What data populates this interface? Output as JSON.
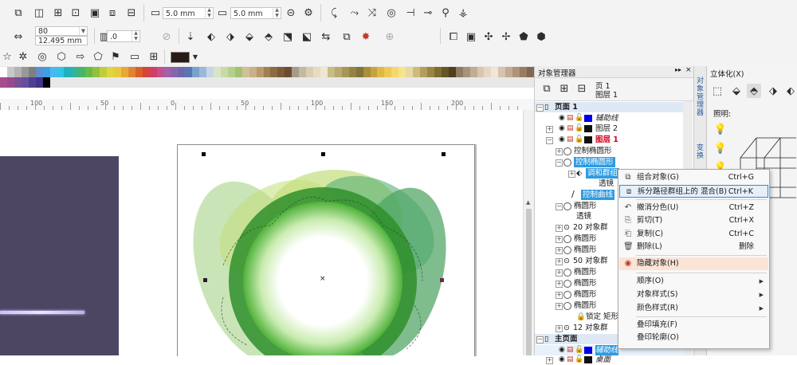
{
  "toolbar1": {
    "nudge1": "5.0 mm",
    "nudge2": "5.0 mm"
  },
  "toolbar2": {
    "width_value": "80",
    "height_value": "12.495 mm",
    "angle_value": ".0"
  },
  "toolbar3": {
    "fill_color": "#2a1a16"
  },
  "palette": {
    "row1": [
      "#ffffff",
      "#c8c8c8",
      "#b3b3b3",
      "#999999",
      "#7f7f7f",
      "#5a8fd1",
      "#3aa0e6",
      "#4ab8f0",
      "#2fc4e8",
      "#20b0c0",
      "#33b39c",
      "#47b46b",
      "#66bb47",
      "#93c13e",
      "#c1cc3a",
      "#ddd63d",
      "#e8c93c",
      "#e6a836",
      "#df8530",
      "#d95f2b",
      "#d4443b",
      "#cf3d68",
      "#c24f8c",
      "#a35fa8",
      "#8865aa",
      "#6b68ab",
      "#5777b4",
      "#7aa1cc",
      "#9ab8d8",
      "#c4d6e6",
      "#d8e4c6",
      "#c9d9a7",
      "#b6cf8a",
      "#a2c26f",
      "#d0c09a",
      "#c8b08a",
      "#b89a6b",
      "#a07f52",
      "#8c6a42",
      "#7b5a36",
      "#6a4c2e",
      "#a59b8a",
      "#c4b99d",
      "#d9ceb0",
      "#e6dcc0",
      "#efe7d0",
      "#c7bb86",
      "#b8aa6e",
      "#a69657",
      "#948443",
      "#83733a",
      "#a98f3a",
      "#c4a43e",
      "#ddb845",
      "#eec956",
      "#f4d86c",
      "#f7e48a",
      "#e8d8a4",
      "#cdbb7d",
      "#b39f5c",
      "#9a8542",
      "#7f6b30",
      "#665525",
      "#4d401c",
      "#8f7a62",
      "#a8927a",
      "#c1ac94",
      "#dac6ae",
      "#e6d7c4",
      "#f0e5d6",
      "#d6c3ae",
      "#c2ab93",
      "#ad937a",
      "#987c62",
      "#826650"
    ],
    "row2": [
      "#a64d8c",
      "#964a8c",
      "#7a4f91",
      "#654fa0",
      "#503f8f",
      "#3e3488",
      "#000000"
    ]
  },
  "ruler": {
    "labels": [
      "100",
      "50",
      "0",
      "50",
      "100",
      "150",
      "200"
    ]
  },
  "object_manager": {
    "title": "对象管理器",
    "page_label": "页 1",
    "layer_label": "图层 1",
    "rows": [
      {
        "text": "页面 1"
      },
      {
        "text": "辅助线"
      },
      {
        "text": "图层 2"
      },
      {
        "text": "图层 1"
      },
      {
        "text": "控制椭圆形"
      },
      {
        "text": "控制椭圆形"
      },
      {
        "text": "调和群组"
      },
      {
        "text": "透镜"
      },
      {
        "text": "控制曲线"
      },
      {
        "text": "椭圆形"
      },
      {
        "text": "透镜"
      },
      {
        "text": "20 对象群"
      },
      {
        "text": "椭圆形"
      },
      {
        "text": "椭圆形"
      },
      {
        "text": "50 对象群"
      },
      {
        "text": "椭圆形"
      },
      {
        "text": "椭圆形"
      },
      {
        "text": "椭圆形"
      },
      {
        "text": "椭圆形"
      },
      {
        "text": "锁定 矩形"
      },
      {
        "text": "12 对象群"
      },
      {
        "text": "主页面"
      },
      {
        "text": "辅助线"
      },
      {
        "text": "桌面"
      }
    ]
  },
  "context_menu": {
    "items": [
      {
        "label": "组合对象(G)",
        "shortcut": "Ctrl+G"
      },
      {
        "label": "拆分路径群组上的 混合(B)",
        "shortcut": "Ctrl+K"
      },
      {
        "label": "撤消分色(U)",
        "shortcut": "Ctrl+Z"
      },
      {
        "label": "剪切(T)",
        "shortcut": "Ctrl+X"
      },
      {
        "label": "复制(C)",
        "shortcut": "Ctrl+C"
      },
      {
        "label": "删除(L)",
        "shortcut": "删除"
      },
      {
        "label": "隐藏对象(H)",
        "shortcut": ""
      },
      {
        "label": "顺序(O)",
        "shortcut": ""
      },
      {
        "label": "对象样式(S)",
        "shortcut": ""
      },
      {
        "label": "颜色样式(R)",
        "shortcut": ""
      },
      {
        "label": "叠印填充(F)",
        "shortcut": ""
      },
      {
        "label": "叠印轮廓(O)",
        "shortcut": ""
      }
    ]
  },
  "side_tabs": {
    "tab1": "对象管理器",
    "tab2": "变换"
  },
  "panel_3d": {
    "title": "立体化(X)",
    "lighting": "照明:"
  }
}
